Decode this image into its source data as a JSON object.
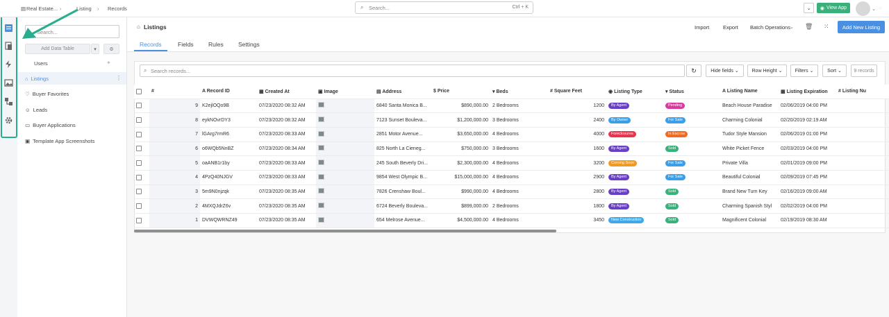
{
  "topbar": {
    "breadcrumb": [
      "Real Estate...",
      "Listing",
      "Records"
    ],
    "search_placeholder": "Search...",
    "search_shortcut": "Ctrl + K",
    "view_app_label": "View App"
  },
  "sidebar": {
    "search_placeholder": "Search...",
    "add_table_label": "Add Data Table",
    "items": [
      {
        "label": "Users"
      },
      {
        "label": "Listings"
      },
      {
        "label": "Buyer Favorites"
      },
      {
        "label": "Leads"
      },
      {
        "label": "Buyer Applications"
      },
      {
        "label": "Template App Screenshots"
      }
    ]
  },
  "main": {
    "title": "Listings",
    "actions": [
      "Import",
      "Export",
      "Batch Operations"
    ],
    "add_button": "Add New Listing",
    "tabs": [
      "Records",
      "Fields",
      "Rules",
      "Settings"
    ],
    "search_placeholder": "Search records...",
    "toolbar": [
      "Hide fields",
      "Row Height",
      "Filters",
      "Sort"
    ],
    "record_count": "9 records"
  },
  "table": {
    "headers": [
      "#",
      "Record ID",
      "Created At",
      "Image",
      "Address",
      "Price",
      "Beds",
      "Square Feet",
      "Listing Type",
      "Status",
      "Listing Name",
      "Listing Expiration",
      "Listing Nu"
    ],
    "rows": [
      {
        "n": "9",
        "id": "K2ejlOQo9B",
        "created": "07/23/2020 08:32 AM",
        "address": "6840 Santa Monica B...",
        "price": "$890,000.00",
        "beds": "2 Bedrooms",
        "sqft": "1200",
        "type": "By Agent",
        "status": "Pending",
        "name": "Beach House Paradise",
        "exp": "02/06/2019 04:00 PM"
      },
      {
        "n": "8",
        "id": "eykNOvrDY3",
        "created": "07/23/2020 08:32 AM",
        "address": "7123 Sunset Bouleva...",
        "price": "$1,200,000.00",
        "beds": "3 Bedrooms",
        "sqft": "2400",
        "type": "By Owner",
        "status": "For Sale",
        "name": "Charming Colonial",
        "exp": "02/20/2019 02:19 AM"
      },
      {
        "n": "7",
        "id": "lGArg7rmR6",
        "created": "07/23/2020 08:33 AM",
        "address": "2851 Motor Avenue...",
        "price": "$3,650,000.00",
        "beds": "4 Bedrooms",
        "sqft": "4000",
        "type": "Foreclosures",
        "status": "In Escrow",
        "name": "Tudor Style Mansion",
        "exp": "02/06/2019 01:00 PM"
      },
      {
        "n": "6",
        "id": "o6WQb5NnBZ",
        "created": "07/23/2020 08:34 AM",
        "address": "825 North La Cieneg...",
        "price": "$750,000.00",
        "beds": "3 Bedrooms",
        "sqft": "1600",
        "type": "By Agent",
        "status": "Sold",
        "name": "White Picket Fence",
        "exp": "02/03/2019 04:00 PM"
      },
      {
        "n": "5",
        "id": "oaANB1r1by",
        "created": "07/23/2020 08:33 AM",
        "address": "245 South Beverly Dri...",
        "price": "$2,300,000.00",
        "beds": "4 Bedrooms",
        "sqft": "3200",
        "type": "Coming Soon",
        "status": "For Sale",
        "name": "Private Villa",
        "exp": "02/01/2019 09:00 PM"
      },
      {
        "n": "4",
        "id": "4PzQ40NJGV",
        "created": "07/23/2020 08:33 AM",
        "address": "9854 West Olympic B...",
        "price": "$15,000,000.00",
        "beds": "4 Bedrooms",
        "sqft": "2900",
        "type": "By Agent",
        "status": "For Sale",
        "name": "Beautiful Colonial",
        "exp": "02/09/2019 07:45 PM"
      },
      {
        "n": "3",
        "id": "5m9N0njzqk",
        "created": "07/23/2020 08:35 AM",
        "address": "7826 Crenshaw Boul...",
        "price": "$990,000.00",
        "beds": "4 Bedrooms",
        "sqft": "2800",
        "type": "By Agent",
        "status": "Sold",
        "name": "Brand New Turn Key",
        "exp": "02/16/2019 09:00 AM"
      },
      {
        "n": "2",
        "id": "4MXQJdrZ6v",
        "created": "07/23/2020 08:35 AM",
        "address": "6724 Beverly Bouleva...",
        "price": "$899,000.00",
        "beds": "2 Bedrooms",
        "sqft": "1800",
        "type": "By Agent",
        "status": "Sold",
        "name": "Charming Spanish Styl",
        "exp": "02/02/2019 04:00 PM"
      },
      {
        "n": "1",
        "id": "DVWQWRNZ49",
        "created": "07/23/2020 08:35 AM",
        "address": "654 Melrose Avenue...",
        "price": "$4,500,000.00",
        "beds": "4 Bedrooms",
        "sqft": "3450",
        "type": "New Construction",
        "status": "Sold",
        "name": "Magnificent Colonial",
        "exp": "02/19/2019 08:30 AM"
      }
    ]
  },
  "colors": {
    "accent": "#4a90e2",
    "green": "#3ab07b",
    "By Agent": "#6a3fc7",
    "By Owner": "#3a9ee8",
    "Foreclosures": "#e8344e",
    "Coming Soon": "#f09a22",
    "New Construction": "#3ea8e8",
    "Pending": "#d83a9e",
    "For Sale": "#3a9ee8",
    "In Escrow": "#f06a22",
    "Sold": "#3ab07b"
  }
}
